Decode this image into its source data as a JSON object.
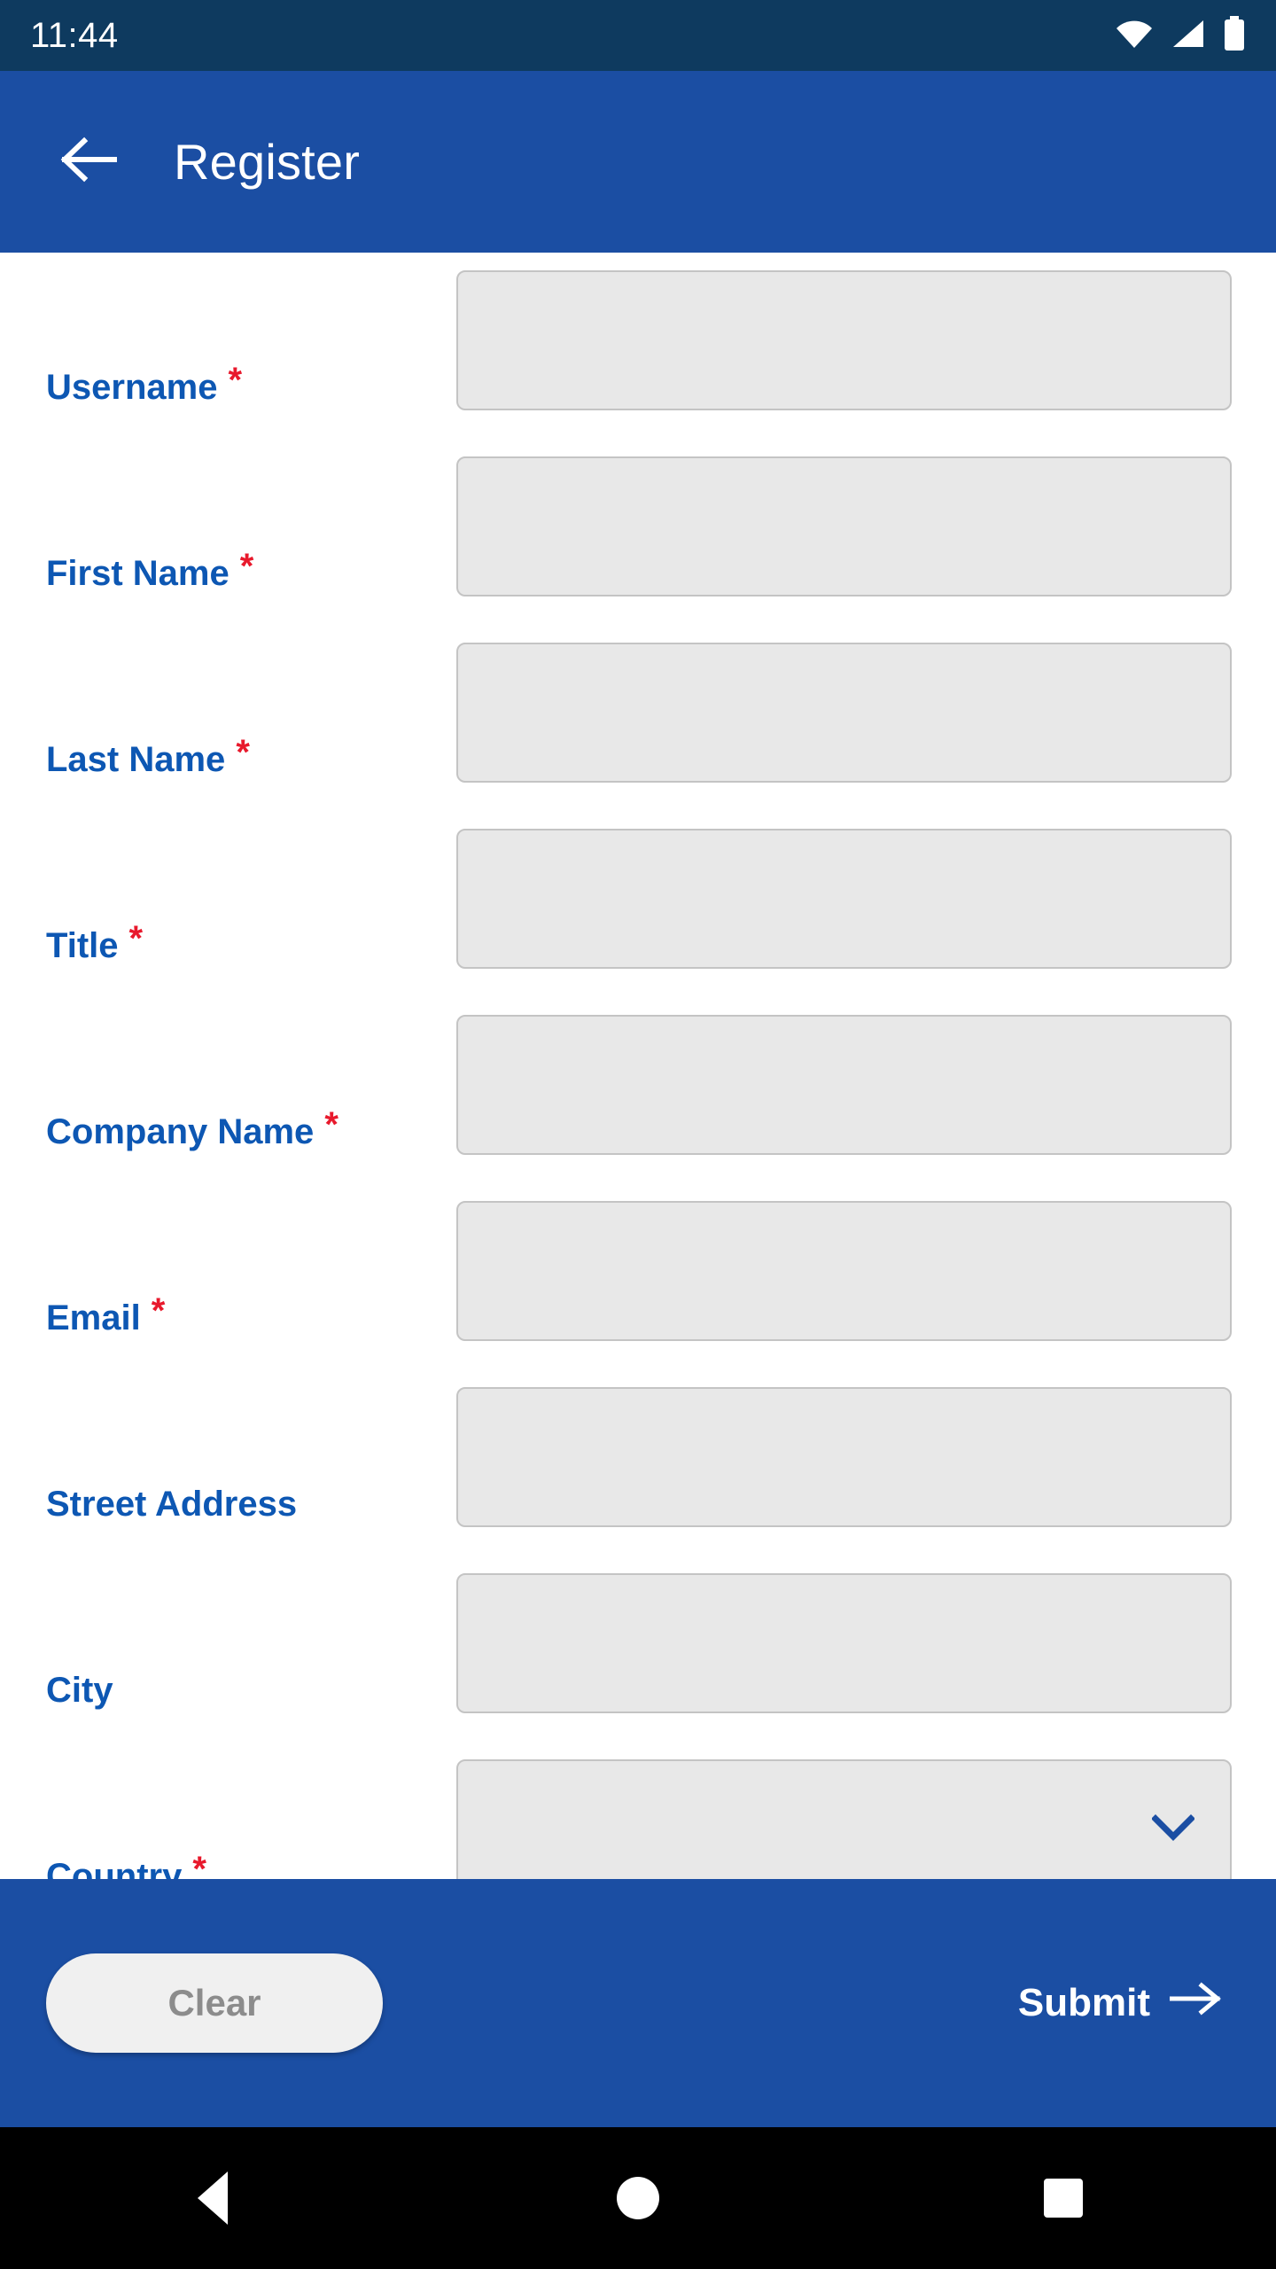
{
  "status_bar": {
    "time": "11:44",
    "icons": [
      "wifi-icon",
      "cellular-signal-icon",
      "battery-icon"
    ],
    "background_color": "#0e3a5f"
  },
  "app_bar": {
    "back_icon": "arrow-left-icon",
    "title": "Register",
    "background_color": "#1b4ea3",
    "text_color": "#ffffff"
  },
  "form": {
    "label_color": "#0d57b3",
    "required_marker": "*",
    "required_marker_color": "#e8192c",
    "field_background": "#e8e8e8",
    "field_border": "#c4c4c4",
    "fields": [
      {
        "label": "Username",
        "required": true,
        "type": "text",
        "value": "",
        "placeholder": ""
      },
      {
        "label": "First Name",
        "required": true,
        "type": "text",
        "value": "",
        "placeholder": ""
      },
      {
        "label": "Last Name",
        "required": true,
        "type": "text",
        "value": "",
        "placeholder": ""
      },
      {
        "label": "Title",
        "required": true,
        "type": "text",
        "value": "",
        "placeholder": ""
      },
      {
        "label": "Company Name",
        "required": true,
        "type": "text",
        "value": "",
        "placeholder": ""
      },
      {
        "label": "Email",
        "required": true,
        "type": "text",
        "value": "",
        "placeholder": ""
      },
      {
        "label": "Street Address",
        "required": false,
        "type": "text",
        "value": "",
        "placeholder": ""
      },
      {
        "label": "City",
        "required": false,
        "type": "text",
        "value": "",
        "placeholder": ""
      },
      {
        "label": "Country",
        "required": true,
        "type": "select",
        "value": "",
        "placeholder": "",
        "icon": "chevron-down-icon"
      }
    ]
  },
  "action_bar": {
    "background_color": "#1b4ea3",
    "clear_label": "Clear",
    "clear_text_color": "#8c8c8c",
    "clear_background": "#f0f0f0",
    "submit_label": "Submit",
    "submit_icon": "arrow-right-icon",
    "submit_text_color": "#ffffff"
  },
  "nav_bar": {
    "background_color": "#000000",
    "buttons": [
      "back-triangle-icon",
      "home-circle-icon",
      "recents-square-icon"
    ]
  }
}
